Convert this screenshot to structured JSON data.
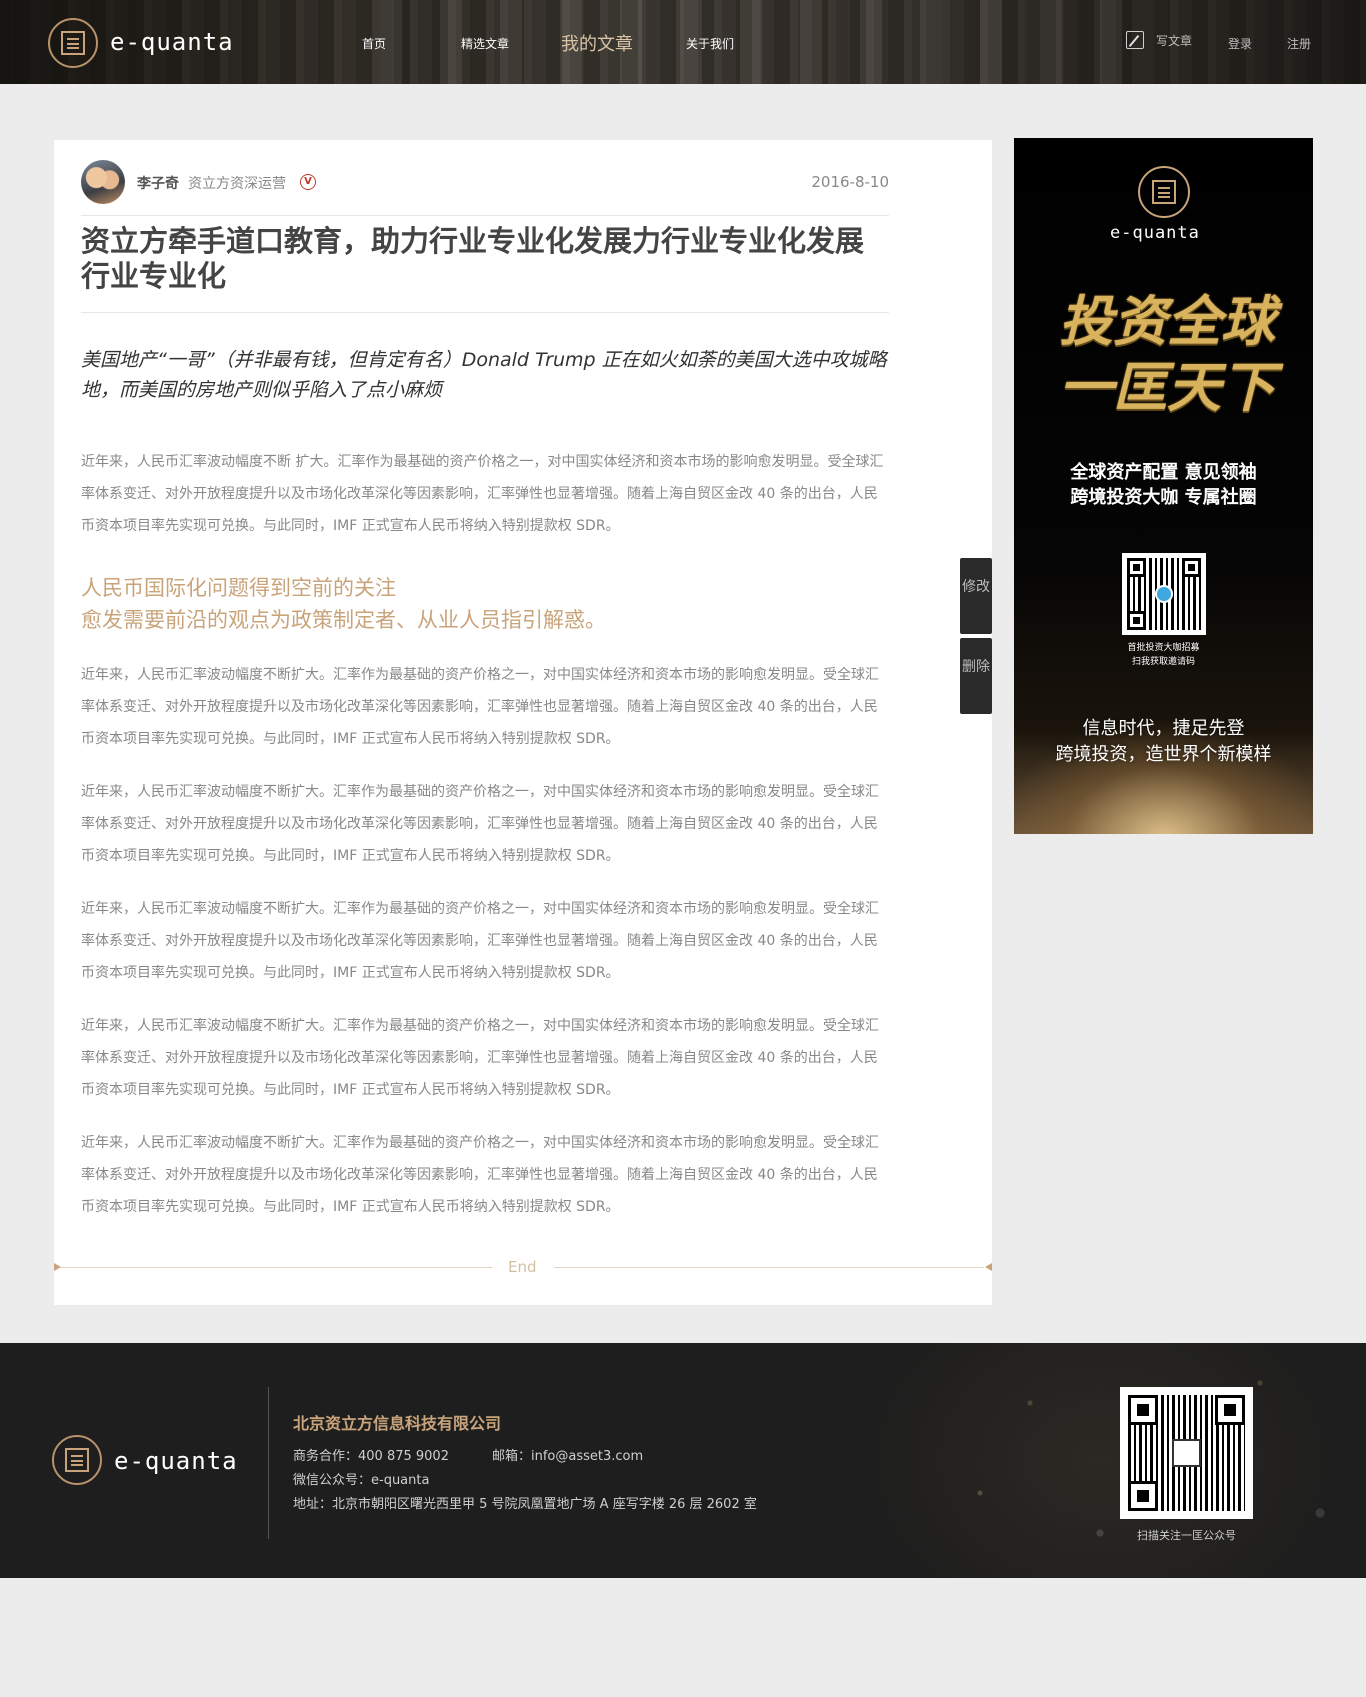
{
  "brand": {
    "name": "e-quanta",
    "gold": "#c9a47b",
    "dark": "#1e1e1e"
  },
  "nav": {
    "items": [
      {
        "label": "首页"
      },
      {
        "label": "精选文章"
      },
      {
        "label": "我的文章",
        "active": true
      },
      {
        "label": "关于我们"
      }
    ],
    "write_label": "写文章",
    "login_label": "登录",
    "register_label": "注册"
  },
  "article": {
    "author": {
      "name": "李子奇",
      "title": "资立方资深运营",
      "verified_mark": "V"
    },
    "date": "2016-8-10",
    "title": "资立方牵手道口教育，助力行业专业化发展力行业专业化发展行业专业化",
    "lead": "美国地产“一哥”（并非最有钱，但肯定有名）Donald Trump 正在如火如荼的美国大选中攻城略地，而美国的房地产则似乎陷入了点小麻烦",
    "paragraphs": [
      "近年来，人民币汇率波动幅度不断 扩大。汇率作为最基础的资产价格之一，对中国实体经济和资本市场的影响愈发明显。受全球汇率体系变迁、对外开放程度提升以及市场化改革深化等因素影响，汇率弹性也显著增强。随着上海自贸区金改 40 条的出台，人民币资本项目率先实现可兑换。与此同时，IMF 正式宣布人民币将纳入特别提款权 SDR。",
      "近年来，人民币汇率波动幅度不断扩大。汇率作为最基础的资产价格之一，对中国实体经济和资本市场的影响愈发明显。受全球汇率体系变迁、对外开放程度提升以及市场化改革深化等因素影响，汇率弹性也显著增强。随着上海自贸区金改 40 条的出台，人民币资本项目率先实现可兑换。与此同时，IMF 正式宣布人民币将纳入特别提款权 SDR。",
      "近年来，人民币汇率波动幅度不断扩大。汇率作为最基础的资产价格之一，对中国实体经济和资本市场的影响愈发明显。受全球汇率体系变迁、对外开放程度提升以及市场化改革深化等因素影响，汇率弹性也显著增强。随着上海自贸区金改 40 条的出台，人民币资本项目率先实现可兑换。与此同时，IMF 正式宣布人民币将纳入特别提款权 SDR。",
      "近年来，人民币汇率波动幅度不断扩大。汇率作为最基础的资产价格之一，对中国实体经济和资本市场的影响愈发明显。受全球汇率体系变迁、对外开放程度提升以及市场化改革深化等因素影响，汇率弹性也显著增强。随着上海自贸区金改 40 条的出台，人民币资本项目率先实现可兑换。与此同时，IMF 正式宣布人民币将纳入特别提款权 SDR。",
      "近年来，人民币汇率波动幅度不断扩大。汇率作为最基础的资产价格之一，对中国实体经济和资本市场的影响愈发明显。受全球汇率体系变迁、对外开放程度提升以及市场化改革深化等因素影响，汇率弹性也显著增强。随着上海自贸区金改 40 条的出台，人民币资本项目率先实现可兑换。与此同时，IMF 正式宣布人民币将纳入特别提款权 SDR。",
      "近年来，人民币汇率波动幅度不断扩大。汇率作为最基础的资产价格之一，对中国实体经济和资本市场的影响愈发明显。受全球汇率体系变迁、对外开放程度提升以及市场化改革深化等因素影响，汇率弹性也显著增强。随着上海自贸区金改 40 条的出台，人民币资本项目率先实现可兑换。与此同时，IMF 正式宣布人民币将纳入特别提款权 SDR。"
    ],
    "subheading": [
      "人民币国际化问题得到空前的关注",
      "愈发需要前沿的观点为政策制定者、从业人员指引解惑。"
    ],
    "end_label": "End"
  },
  "actions": {
    "edit_label": "修改",
    "delete_label": "删除"
  },
  "ad": {
    "brand": "e-quanta",
    "slogan": "投资全球 一匡天下",
    "tagline": [
      "全球资产配置 意见领袖",
      "跨境投资大咖 专属社圈"
    ],
    "qr_caption": [
      "首批投资大咖招募",
      "扫我获取邀请码"
    ],
    "bottom_text": [
      "信息时代，捷足先登",
      "跨境投资，造世界个新模样"
    ]
  },
  "footer": {
    "brand": "e-quanta",
    "company": "北京资立方信息科技有限公司",
    "business": "商务合作：400 875 9002",
    "email": "邮箱：info@asset3.com",
    "wechat": "微信公众号：e-quanta",
    "address": "地址：北京市朝阳区曙光西里甲 5 号院凤凰置地广场 A 座写字楼 26 层 2602 室",
    "qr_caption": "扫描关注一匡公众号"
  }
}
